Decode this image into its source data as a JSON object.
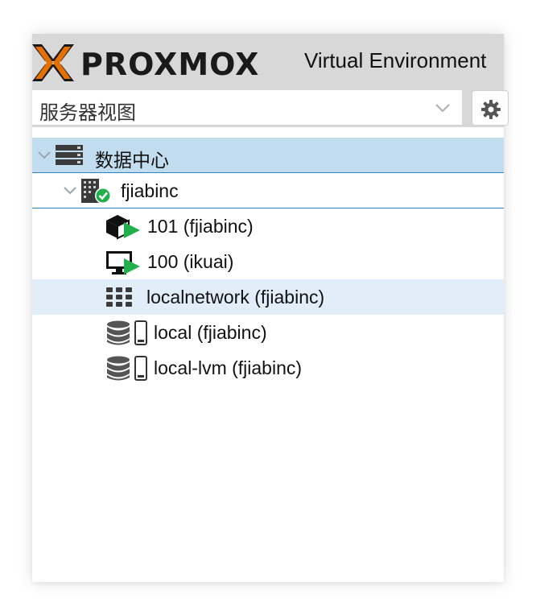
{
  "header": {
    "logo_text": "PROXMOX",
    "subtitle": "Virtual Environment",
    "logo_colors": {
      "x_accent": "#e57000",
      "x_dark": "#1a1a1a",
      "text": "#1a1a1a"
    }
  },
  "toolbar": {
    "view_selector": {
      "value": "服务器视图",
      "icon": "chevron-down-icon"
    },
    "settings_button": {
      "icon": "gear-icon"
    }
  },
  "tree": {
    "datacenter": {
      "label": "数据中心",
      "icon": "datacenter-icon",
      "state": "expanded",
      "selected": true
    },
    "node": {
      "label": "fjiabinc",
      "icon": "node-icon",
      "status": "online",
      "state": "expanded"
    },
    "resources": [
      {
        "label": "101 (fjiabinc)",
        "icon": "container-running-icon",
        "status": "running"
      },
      {
        "label": "100 (ikuai)",
        "icon": "vm-running-icon",
        "status": "running"
      },
      {
        "label": "localnetwork (fjiabinc)",
        "icon": "network-icon",
        "status": "hovered"
      },
      {
        "label": "local (fjiabinc)",
        "icon": "storage-icon"
      },
      {
        "label": "local-lvm (fjiabinc)",
        "icon": "storage-icon"
      }
    ]
  },
  "colors": {
    "selected_row": "#c2dcf0",
    "hover_row": "#e1edf8",
    "selection_border": "#2f7fc1",
    "running_green": "#21b04b",
    "header_bg": "#d8d8d8"
  }
}
